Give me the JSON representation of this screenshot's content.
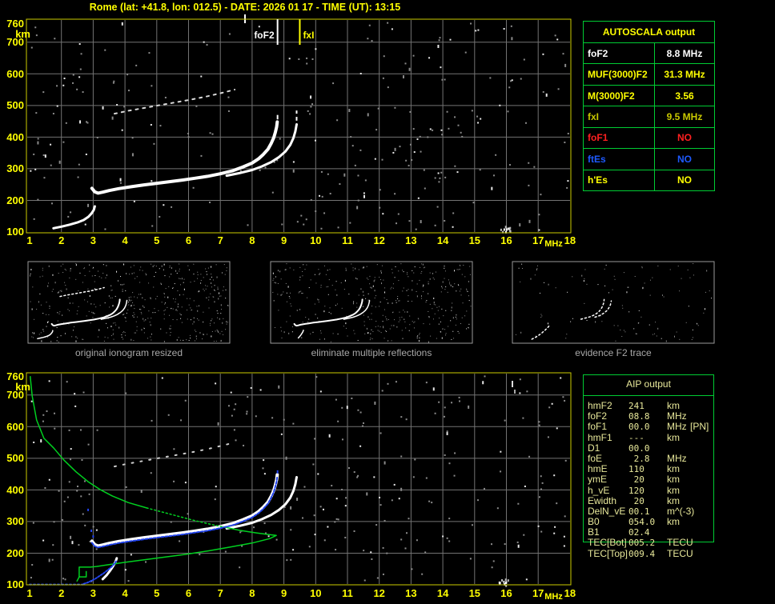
{
  "title": "Rome (lat: +41.8, lon: 012.5) - DATE: 2026 01 17 - TIME (UT): 13:15",
  "colors": {
    "background": "#000000",
    "frame_yellow": "#cbcb00",
    "label_yellow": "#ffff00",
    "grid_gray": "#737373",
    "table_green": "#00cc33",
    "aip_text": "#e8e89a",
    "trace_white": "#ffffff",
    "restored_blue": "#2244ee",
    "profile_green": "#00d020",
    "caption_gray": "#a8a8a8"
  },
  "autoscala": {
    "header": "AUTOSCALA output",
    "rows": [
      {
        "param": "foF2",
        "value": "8.8 MHz",
        "color": "#ffffff"
      },
      {
        "param": "MUF(3000)F2",
        "value": "31.3 MHz",
        "color": "#ffff00"
      },
      {
        "param": "M(3000)F2",
        "value": "3.56",
        "color": "#ffff00"
      },
      {
        "param": "fxI",
        "value": "9.5 MHz",
        "color": "#c8c800"
      },
      {
        "param": "foF1",
        "value": "NO",
        "color": "#ff2020"
      },
      {
        "param": "ftEs",
        "value": "NO",
        "color": "#1e5aff"
      },
      {
        "param": "h'Es",
        "value": "NO",
        "color": "#ffff00"
      }
    ]
  },
  "aip": {
    "header": "AIP output",
    "rows": [
      {
        "param": "hmF2",
        "value": "241",
        "unit": "km",
        "extra": ""
      },
      {
        "param": "foF2",
        "value": "08.8",
        "unit": "MHz",
        "extra": ""
      },
      {
        "param": "foF1",
        "value": "00.0",
        "unit": "MHz",
        "extra": "[PN]"
      },
      {
        "param": "hmF1",
        "value": "---",
        "unit": "km",
        "extra": ""
      },
      {
        "param": "D1",
        "value": "00.0",
        "unit": "",
        "extra": ""
      },
      {
        "param": "foE",
        "value": " 2.8",
        "unit": "MHz",
        "extra": ""
      },
      {
        "param": "hmE",
        "value": "110",
        "unit": "km",
        "extra": ""
      },
      {
        "param": "ymE",
        "value": " 20",
        "unit": "km",
        "extra": ""
      },
      {
        "param": "h_vE",
        "value": "120",
        "unit": "km",
        "extra": ""
      },
      {
        "param": "Ewidth",
        "value": " 20",
        "unit": "km",
        "extra": ""
      },
      {
        "param": "DelN_vE",
        "value": "00.1",
        "unit": "m^(-3)",
        "extra": ""
      },
      {
        "param": "B0",
        "value": "054.0",
        "unit": "km",
        "extra": ""
      },
      {
        "param": "B1",
        "value": "02.4",
        "unit": "",
        "extra": ""
      },
      {
        "param": "TEC[Bot]",
        "value": "005.2",
        "unit": "TECU",
        "extra": ""
      },
      {
        "param": "TEC[Top]",
        "value": "009.4",
        "unit": "TECU",
        "extra": ""
      }
    ]
  },
  "thumbnails": [
    {
      "caption": "original ionogram resized"
    },
    {
      "caption": "eliminate multiple reflections"
    },
    {
      "caption": "evidence F2 trace"
    }
  ],
  "traces": {
    "f_trace": [
      [
        2.96,
        238
      ],
      [
        3.05,
        227
      ],
      [
        3.15,
        223
      ],
      [
        3.3,
        226
      ],
      [
        3.5,
        231
      ],
      [
        3.8,
        237
      ],
      [
        4.2,
        243
      ],
      [
        4.6,
        249
      ],
      [
        5.0,
        254
      ],
      [
        5.4,
        259
      ],
      [
        5.8,
        264
      ],
      [
        6.2,
        270
      ],
      [
        6.6,
        276
      ],
      [
        7.0,
        284
      ],
      [
        7.4,
        294
      ],
      [
        7.7,
        305
      ],
      [
        8.0,
        318
      ],
      [
        8.2,
        331
      ],
      [
        8.35,
        345
      ],
      [
        8.5,
        362
      ],
      [
        8.6,
        380
      ],
      [
        8.68,
        398
      ],
      [
        8.73,
        415
      ],
      [
        8.77,
        432
      ],
      [
        8.79,
        448
      ]
    ],
    "x_branch": [
      [
        7.2,
        278
      ],
      [
        7.6,
        286
      ],
      [
        8.0,
        296
      ],
      [
        8.3,
        307
      ],
      [
        8.6,
        321
      ],
      [
        8.85,
        337
      ],
      [
        9.05,
        355
      ],
      [
        9.2,
        375
      ],
      [
        9.3,
        397
      ],
      [
        9.36,
        418
      ],
      [
        9.4,
        440
      ]
    ],
    "e_trace": [
      [
        1.75,
        112
      ],
      [
        2.0,
        117
      ],
      [
        2.25,
        123
      ],
      [
        2.5,
        130
      ],
      [
        2.7,
        138
      ],
      [
        2.85,
        148
      ],
      [
        2.95,
        159
      ],
      [
        3.02,
        170
      ],
      [
        3.05,
        181
      ]
    ],
    "e_blob": [
      [
        3.3,
        118
      ],
      [
        3.42,
        130
      ],
      [
        3.52,
        143
      ],
      [
        3.62,
        158
      ],
      [
        3.7,
        172
      ],
      [
        3.74,
        184
      ]
    ],
    "second_hop": [
      [
        3.67,
        474
      ],
      [
        4.1,
        483
      ],
      [
        4.6,
        492
      ],
      [
        5.1,
        501
      ],
      [
        5.6,
        510
      ],
      [
        6.1,
        519
      ],
      [
        6.6,
        529
      ],
      [
        7.1,
        541
      ],
      [
        7.45,
        550
      ]
    ],
    "green_a": [
      [
        1.02,
        758
      ],
      [
        1.08,
        697
      ],
      [
        1.22,
        621
      ],
      [
        1.45,
        563
      ],
      [
        1.76,
        532
      ],
      [
        2.08,
        494
      ],
      [
        2.46,
        457
      ],
      [
        2.84,
        426
      ],
      [
        3.22,
        401
      ],
      [
        3.6,
        381
      ],
      [
        4.1,
        360
      ],
      [
        4.68,
        343
      ]
    ],
    "green_b": [
      [
        4.68,
        343
      ],
      [
        5.36,
        325
      ],
      [
        6.11,
        305
      ],
      [
        6.87,
        287
      ],
      [
        7.1,
        283
      ]
    ],
    "green_c": [
      [
        7.1,
        283
      ],
      [
        7.62,
        272
      ],
      [
        8.13,
        264
      ],
      [
        8.51,
        259
      ],
      [
        8.76,
        256
      ],
      [
        8.55,
        246
      ],
      [
        8.0,
        232
      ],
      [
        7.3,
        219
      ],
      [
        6.6,
        207
      ],
      [
        5.9,
        196
      ],
      [
        5.2,
        187
      ],
      [
        4.6,
        179
      ],
      [
        4.0,
        171
      ],
      [
        3.5,
        164
      ],
      [
        3.1,
        158
      ],
      [
        2.91,
        156
      ],
      [
        2.56,
        156
      ],
      [
        2.56,
        125
      ],
      [
        2.78,
        125
      ],
      [
        2.78,
        142
      ]
    ],
    "green_tail": [
      [
        2.56,
        125
      ],
      [
        2.49,
        112
      ]
    ],
    "blue_flat": [
      [
        1.0,
        101
      ],
      [
        2.68,
        101
      ]
    ],
    "blue_rise": [
      [
        2.7,
        103
      ],
      [
        2.82,
        107
      ],
      [
        2.95,
        113
      ],
      [
        3.08,
        120
      ],
      [
        3.2,
        128
      ],
      [
        3.32,
        136
      ],
      [
        3.45,
        146
      ],
      [
        3.58,
        157
      ],
      [
        3.68,
        168
      ],
      [
        3.74,
        178
      ]
    ],
    "blue_f": [
      [
        2.96,
        233
      ],
      [
        3.05,
        222
      ],
      [
        3.15,
        218
      ],
      [
        3.3,
        221
      ],
      [
        3.5,
        226
      ],
      [
        3.8,
        232
      ],
      [
        4.2,
        238
      ],
      [
        4.6,
        244
      ],
      [
        5.0,
        249
      ],
      [
        5.4,
        254
      ],
      [
        5.8,
        259
      ],
      [
        6.2,
        265
      ],
      [
        6.6,
        271
      ],
      [
        7.0,
        279
      ],
      [
        7.4,
        289
      ],
      [
        7.7,
        300
      ],
      [
        8.0,
        313
      ],
      [
        8.2,
        326
      ],
      [
        8.35,
        340
      ],
      [
        8.5,
        357
      ],
      [
        8.6,
        375
      ],
      [
        8.68,
        393
      ],
      [
        8.73,
        410
      ],
      [
        8.77,
        427
      ],
      [
        8.79,
        443
      ]
    ],
    "blue_dots": [
      [
        2.84,
        338
      ],
      [
        2.94,
        272
      ],
      [
        3.0,
        254
      ]
    ],
    "f_rise": [
      [
        6.8,
        279
      ],
      [
        7.2,
        289
      ],
      [
        7.6,
        300
      ],
      [
        8.0,
        318
      ],
      [
        8.3,
        340
      ],
      [
        8.5,
        362
      ],
      [
        8.65,
        390
      ],
      [
        8.75,
        420
      ],
      [
        8.79,
        448
      ]
    ],
    "x_rise": [
      [
        8.0,
        296
      ],
      [
        8.4,
        310
      ],
      [
        8.8,
        333
      ],
      [
        9.05,
        355
      ],
      [
        9.2,
        378
      ],
      [
        9.32,
        402
      ],
      [
        9.4,
        436
      ]
    ],
    "cusp_fragment": [
      [
        2.6,
        107
      ],
      [
        3.0,
        128
      ],
      [
        3.35,
        152
      ],
      [
        3.7,
        182
      ],
      [
        4.0,
        212
      ],
      [
        4.15,
        232
      ]
    ]
  },
  "chart_data": [
    {
      "id": "top-ionogram",
      "type": "scatter",
      "title": "scaled ionogram",
      "xlabel": "MHz",
      "ylabel": "km",
      "x_ticks": [
        1,
        2,
        3,
        4,
        5,
        6,
        7,
        8,
        9,
        10,
        11,
        12,
        13,
        14,
        15,
        16,
        17,
        18
      ],
      "y_ticks": [
        760,
        700,
        600,
        500,
        400,
        300,
        200,
        100
      ],
      "xlim": [
        1,
        18
      ],
      "ylim": [
        100,
        760
      ],
      "grid": true,
      "series": [
        {
          "name": "E-trace",
          "points": "e_trace",
          "color": "#ffffff",
          "width": 3,
          "dash": ""
        },
        {
          "name": "F-trace-ordinary",
          "points": "f_trace",
          "color": "#ffffff",
          "width": 4,
          "dash": ""
        },
        {
          "name": "F-trace-extraordinary",
          "points": "x_branch",
          "color": "#ffffff",
          "width": 3,
          "dash": ""
        },
        {
          "name": "second-hop",
          "points": "second_hop",
          "color": "#d9d9d9",
          "width": 2,
          "dash": "3 6"
        },
        {
          "name": "foF2-top-dash",
          "type": "vdash",
          "color": "#ffffff",
          "segs": [
            [
              8.8,
              456,
              470
            ],
            [
              9.4,
              452,
              464
            ],
            [
              9.4,
              474,
              484
            ]
          ]
        }
      ],
      "markers": [
        {
          "label": "foF2",
          "f": 8.8,
          "color": "#ffffff",
          "side": "left"
        },
        {
          "label": "fxI",
          "f": 9.5,
          "color": "#ffff00",
          "side": "right"
        }
      ],
      "noise": {
        "seed": 7,
        "count": 170,
        "right_extra": 70,
        "left_extra": 26,
        "cluster": [
          630,
          286
        ]
      },
      "artifacts": [
        [
          305,
          18,
          2,
          11,
          "#ffffff"
        ]
      ]
    },
    {
      "id": "bottom-ionogram",
      "type": "scatter",
      "title": "restored ionogram with electron density profile",
      "xlabel": "MHz",
      "ylabel": "km",
      "x_ticks": [
        1,
        2,
        3,
        4,
        5,
        6,
        7,
        8,
        9,
        10,
        11,
        12,
        13,
        14,
        15,
        16,
        17,
        18
      ],
      "y_ticks": [
        760,
        700,
        600,
        500,
        400,
        300,
        200,
        100
      ],
      "xlim": [
        1,
        18
      ],
      "ylim": [
        100,
        760
      ],
      "grid": true,
      "series": [
        {
          "name": "F-trace-ordinary",
          "points": "f_trace",
          "color": "#ffffff",
          "width": 4,
          "dash": ""
        },
        {
          "name": "F-trace-extraordinary",
          "points": "x_branch",
          "color": "#ffffff",
          "width": 3,
          "dash": ""
        },
        {
          "name": "E-blob",
          "points": "e_blob",
          "color": "#ffffff",
          "width": 3,
          "dash": ""
        },
        {
          "name": "second-hop",
          "points": "second_hop",
          "color": "#cfcfcf",
          "width": 2,
          "dash": "2 9"
        },
        {
          "name": "profile-upper",
          "points": "green_a",
          "color": "#00d020",
          "width": 1.5,
          "dash": ""
        },
        {
          "name": "profile-mid-dotted",
          "points": "green_b",
          "color": "#00d020",
          "width": 1.5,
          "dash": "2 3"
        },
        {
          "name": "profile-lower",
          "points": "green_c",
          "color": "#00d020",
          "width": 1.5,
          "dash": ""
        },
        {
          "name": "profile-tail",
          "points": "green_tail",
          "color": "#00d020",
          "width": 1.5,
          "dash": ""
        },
        {
          "name": "restored-flat",
          "points": "blue_flat",
          "color": "#2244ee",
          "width": 2,
          "dash": "2 3"
        },
        {
          "name": "restored-rise",
          "points": "blue_rise",
          "color": "#2244ee",
          "width": 2,
          "dash": "2 2"
        },
        {
          "name": "restored-F",
          "points": "blue_f",
          "color": "#2244ee",
          "width": 2,
          "dash": "3 2"
        },
        {
          "name": "restored-isolated",
          "type": "dots",
          "points": "blue_dots",
          "color": "#2244ee"
        },
        {
          "name": "restored-top-dash",
          "type": "vdash",
          "color": "#2244ee",
          "segs": [
            [
              8.8,
              452,
              462
            ]
          ]
        }
      ],
      "markers": [],
      "noise": {
        "seed": 21,
        "count": 170,
        "right_extra": 70,
        "left_extra": 26,
        "cluster": [
          630,
          727
        ]
      },
      "artifacts": [
        [
          639,
          476,
          2,
          8,
          "#dddddd"
        ],
        [
          642,
          487,
          2,
          5,
          "#aaaaaa"
        ]
      ]
    },
    {
      "id": "thumb-original",
      "type": "scatter",
      "title": "original ionogram resized",
      "series": [
        {
          "name": "F-trace",
          "points": "f_trace",
          "color": "#ffffff",
          "width": 2,
          "dash": ""
        },
        {
          "name": "x-branch",
          "points": "x_branch",
          "color": "#ffffff",
          "width": 1.5,
          "dash": ""
        },
        {
          "name": "E-trace",
          "points": "e_trace",
          "color": "#ffffff",
          "width": 1.5,
          "dash": ""
        },
        {
          "name": "second-hop",
          "points": "second_hop",
          "color": "#ffffff",
          "width": 1.5,
          "dash": "2 3"
        }
      ],
      "noise": {
        "seed": 11,
        "count": 340,
        "right_extra": 140
      }
    },
    {
      "id": "thumb-cleaned",
      "type": "scatter",
      "title": "eliminate multiple reflections",
      "series": [
        {
          "name": "F-trace",
          "points": "f_trace",
          "color": "#ffffff",
          "width": 2,
          "dash": ""
        },
        {
          "name": "x-branch",
          "points": "x_branch",
          "color": "#ffffff",
          "width": 1.5,
          "dash": ""
        },
        {
          "name": "E-trace",
          "points": "e_blob",
          "color": "#ffffff",
          "width": 1.5,
          "dash": ""
        }
      ],
      "noise": {
        "seed": 12,
        "count": 300,
        "right_extra": 120
      }
    },
    {
      "id": "thumb-evidence",
      "type": "scatter",
      "title": "evidence F2 trace",
      "series": [
        {
          "name": "F-rise",
          "points": "f_rise",
          "color": "#ffffff",
          "width": 1.5,
          "dash": "2 3"
        },
        {
          "name": "x-rise",
          "points": "x_rise",
          "color": "#ffffff",
          "width": 1.5,
          "dash": "2 3"
        },
        {
          "name": "cusp",
          "points": "cusp_fragment",
          "color": "#ffffff",
          "width": 1.5,
          "dash": "2 3"
        }
      ],
      "noise": {
        "seed": 13,
        "count": 90,
        "right_extra": 20
      }
    }
  ]
}
